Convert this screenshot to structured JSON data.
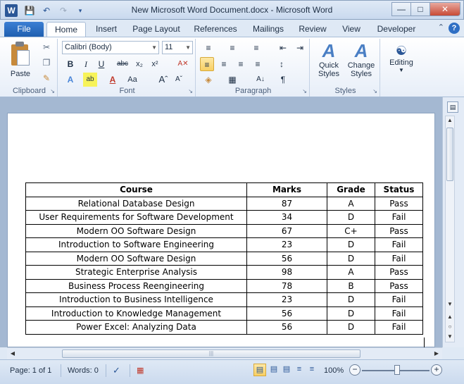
{
  "window": {
    "title": "New Microsoft Word Document.docx  -  Microsoft Word",
    "app_icon": "W",
    "buttons": {
      "minimize": "—",
      "maximize": "□",
      "close": "✕"
    }
  },
  "tabs": [
    "File",
    "Home",
    "Insert",
    "Page Layout",
    "References",
    "Mailings",
    "Review",
    "View",
    "Developer"
  ],
  "active_tab": "Home",
  "ribbon": {
    "clipboard": {
      "label": "Clipboard",
      "paste": "Paste"
    },
    "font": {
      "label": "Font",
      "family": "Calibri (Body)",
      "size": "11"
    },
    "paragraph": {
      "label": "Paragraph"
    },
    "styles": {
      "label": "Styles",
      "quick_styles": "Quick Styles",
      "change_styles": "Change Styles"
    },
    "editing": {
      "label": "Editing"
    }
  },
  "document": {
    "table": {
      "headers": [
        "Course",
        "Marks",
        "Grade",
        "Status"
      ],
      "rows": [
        [
          "Relational Database Design",
          "87",
          "A",
          "Pass"
        ],
        [
          "User Requirements for Software Development",
          "34",
          "D",
          "Fail"
        ],
        [
          "Modern OO Software Design",
          "67",
          "C+",
          "Pass"
        ],
        [
          "Introduction to Software Engineering",
          "23",
          "D",
          "Fail"
        ],
        [
          "Modern OO Software Design",
          "56",
          "D",
          "Fail"
        ],
        [
          "Strategic Enterprise Analysis",
          "98",
          "A",
          "Pass"
        ],
        [
          "Business Process Reengineering",
          "78",
          "B",
          "Pass"
        ],
        [
          "Introduction to Business Intelligence",
          "23",
          "D",
          "Fail"
        ],
        [
          "Introduction to Knowledge Management",
          "56",
          "D",
          "Fail"
        ],
        [
          "Power Excel: Analyzing Data",
          "56",
          "D",
          "Fail"
        ]
      ]
    }
  },
  "status": {
    "page": "Page: 1 of 1",
    "words": "Words: 0",
    "zoom": "100%",
    "zoom_level": 100
  },
  "colors": {
    "file_tab": "#2b67c0",
    "accent": "#2b5797",
    "highlight": "#f8cf63"
  }
}
